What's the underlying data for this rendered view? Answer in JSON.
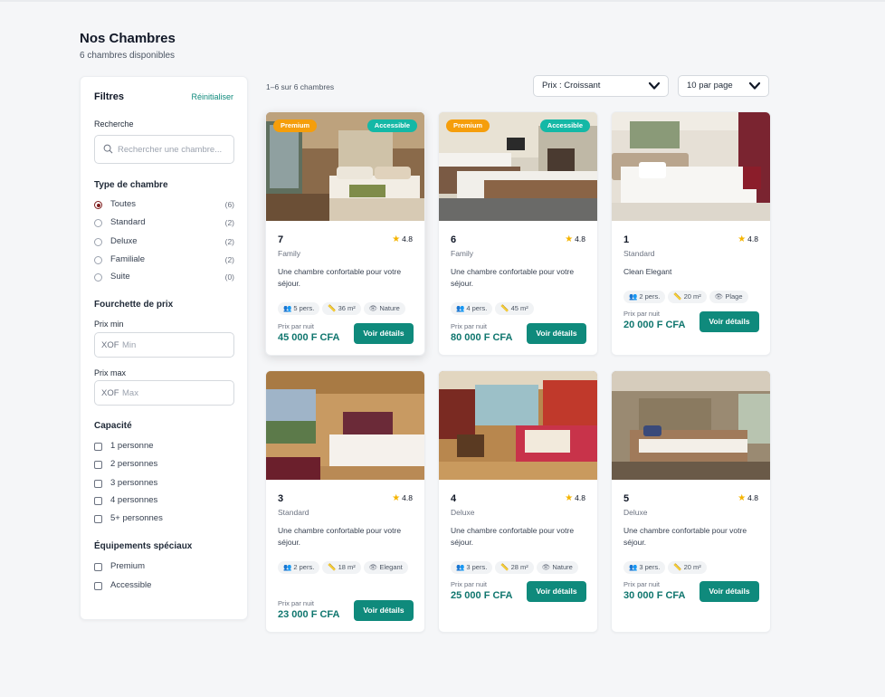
{
  "header": {
    "title": "Nos Chambres",
    "subtitle": "6 chambres disponibles"
  },
  "filters": {
    "title": "Filtres",
    "reset": "Réinitialiser",
    "search": {
      "label": "Recherche",
      "placeholder": "Rechercher une chambre..."
    },
    "room_type": {
      "title": "Type de chambre",
      "options": [
        {
          "label": "Toutes",
          "count": "(6)",
          "selected": true
        },
        {
          "label": "Standard",
          "count": "(2)"
        },
        {
          "label": "Deluxe",
          "count": "(2)"
        },
        {
          "label": "Familiale",
          "count": "(2)"
        },
        {
          "label": "Suite",
          "count": "(0)"
        }
      ]
    },
    "price_range": {
      "title": "Fourchette de prix",
      "min_label": "Prix min",
      "max_label": "Prix max",
      "currency": "XOF",
      "min_placeholder": "Min",
      "max_placeholder": "Max"
    },
    "capacity": {
      "title": "Capacité",
      "options": [
        "1 personne",
        "2 personnes",
        "3 personnes",
        "4 personnes",
        "5+ personnes"
      ]
    },
    "special": {
      "title": "Équipements spéciaux",
      "options": [
        "Premium",
        "Accessible"
      ]
    }
  },
  "toolbar": {
    "results": "1–6 sur 6 chambres",
    "sort": "Prix : Croissant",
    "per_page": "10 par page"
  },
  "labels": {
    "price_per_night": "Prix par nuit",
    "details_button": "Voir détails",
    "premium": "Premium",
    "accessible": "Accessible"
  },
  "rooms": [
    {
      "number": "7",
      "type": "Family",
      "rating": "4.8",
      "description": "Une chambre confortable pour votre séjour.",
      "chips": [
        "5 pers.",
        "36 m²",
        "Nature"
      ],
      "price": "45 000 F CFA",
      "premium": true,
      "accessible": true
    },
    {
      "number": "6",
      "type": "Family",
      "rating": "4.8",
      "description": "Une chambre confortable pour votre séjour.",
      "chips": [
        "4 pers.",
        "45 m²"
      ],
      "price": "80 000 F CFA",
      "premium": true,
      "accessible": true
    },
    {
      "number": "1",
      "type": "Standard",
      "rating": "4.8",
      "description": "Clean Elegant",
      "chips": [
        "2 pers.",
        "20 m²",
        "Plage"
      ],
      "price": "20 000 F CFA"
    },
    {
      "number": "3",
      "type": "Standard",
      "rating": "4.8",
      "description": "Une chambre confortable pour votre séjour.",
      "chips": [
        "2 pers.",
        "18 m²",
        "Elegant"
      ],
      "price": "23 000 F CFA"
    },
    {
      "number": "4",
      "type": "Deluxe",
      "rating": "4.8",
      "description": "Une chambre confortable pour votre séjour.",
      "chips": [
        "3 pers.",
        "28 m²",
        "Nature"
      ],
      "price": "25 000 F CFA"
    },
    {
      "number": "5",
      "type": "Deluxe",
      "rating": "4.8",
      "description": "Une chambre confortable pour votre séjour.",
      "chips": [
        "3 pers.",
        "20 m²"
      ],
      "price": "30 000 F CFA"
    }
  ],
  "colors": {
    "accent": "#0f8a7c",
    "price": "#0f766e",
    "premium": "#f59e0b",
    "accessible": "#14b8a6",
    "star": "#f5b400"
  }
}
